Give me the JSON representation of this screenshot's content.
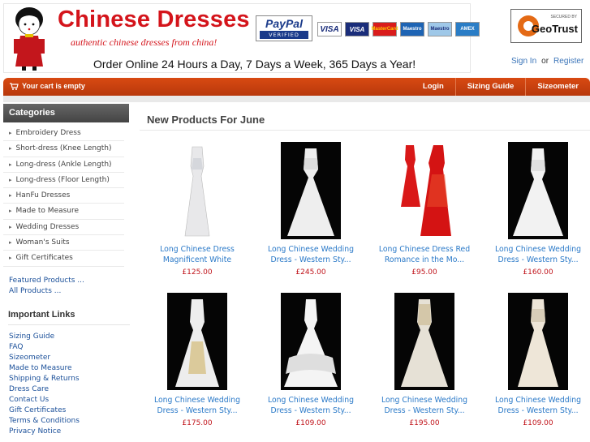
{
  "header": {
    "brand_title": "Chinese Dresses",
    "tagline": "authentic chinese dresses from china!",
    "order_line": "Order Online 24 Hours a Day, 7 Days a Week, 365 Days a Year!",
    "paypal_text": "PayPal",
    "paypal_verified": "VERIFIED",
    "cards": [
      "VISA",
      "VISA",
      "MasterCard",
      "Maestro",
      "Maestro",
      "AMEX"
    ],
    "geotrust_secured": "SECURED BY",
    "geotrust_name": "GeoTrust",
    "sign_in": "Sign In",
    "or": "or",
    "register": "Register"
  },
  "navbar": {
    "cart_text": "Your cart is empty",
    "links": [
      "Login",
      "Sizing Guide",
      "Sizeometer"
    ]
  },
  "sidebar": {
    "categories_title": "Categories",
    "categories": [
      "Embroidery Dress",
      "Short-dress (Knee Length)",
      "Long-dress (Ankle Length)",
      "Long-dress (Floor Length)",
      "HanFu Dresses",
      "Made to Measure",
      "Wedding Dresses",
      "Woman's Suits",
      "Gift Certificates"
    ],
    "featured": "Featured Products ...",
    "all": "All Products ...",
    "important_title": "Important Links",
    "important": [
      "Sizing Guide",
      "FAQ",
      "Sizeometer",
      "Made to Measure",
      "Shipping & Returns",
      "Dress Care",
      "Contact Us",
      "Gift Certificates",
      "Terms & Conditions",
      "Privacy Notice"
    ]
  },
  "main": {
    "title": "New Products For June",
    "products": [
      {
        "name": "Long Chinese Dress Magnificent White",
        "price": "£125.00"
      },
      {
        "name": "Long Chinese Wedding Dress - Western Sty...",
        "price": "£245.00"
      },
      {
        "name": "Long Chinese Dress Red Romance in the Mo...",
        "price": "£95.00"
      },
      {
        "name": "Long Chinese Wedding Dress - Western Sty...",
        "price": "£160.00"
      },
      {
        "name": "Long Chinese Wedding Dress - Western Sty...",
        "price": "£175.00"
      },
      {
        "name": "Long Chinese Wedding Dress - Western Sty...",
        "price": "£109.00"
      },
      {
        "name": "Long Chinese Wedding Dress - Western Sty...",
        "price": "£195.00"
      },
      {
        "name": "Long Chinese Wedding Dress - Western Sty...",
        "price": "£109.00"
      }
    ]
  },
  "colors": {
    "brand_red": "#d4141b",
    "nav_orange": "#c8410e",
    "link_blue": "#2a79c8",
    "price_red": "#c0141b"
  }
}
